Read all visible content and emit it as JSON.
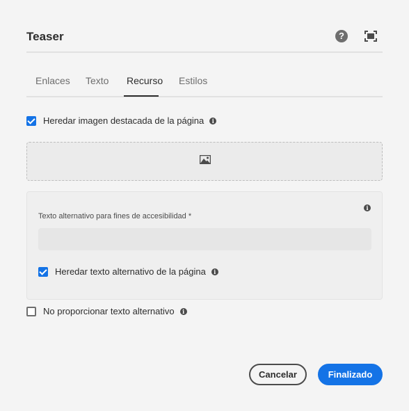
{
  "dialog": {
    "title": "Teaser",
    "help_icon": "help-icon",
    "fullscreen_icon": "fullscreen-icon"
  },
  "tabs": [
    {
      "label": "Enlaces",
      "active": false
    },
    {
      "label": "Texto",
      "active": false
    },
    {
      "label": "Recurso",
      "active": true
    },
    {
      "label": "Estilos",
      "active": false
    }
  ],
  "asset": {
    "inherit_image_label": "Heredar imagen destacada de la página",
    "inherit_image_checked": true,
    "dropzone_icon": "image-icon",
    "alt_text_label": "Texto alternativo para fines de accesibilidad *",
    "alt_text_value": "",
    "inherit_alt_label": "Heredar texto alternativo de la página",
    "inherit_alt_checked": true,
    "no_alt_label": "No proporcionar texto alternativo",
    "no_alt_checked": false
  },
  "footer": {
    "cancel_label": "Cancelar",
    "done_label": "Finalizado"
  },
  "colors": {
    "accent": "#1473e6",
    "background": "#f4f4f4"
  }
}
